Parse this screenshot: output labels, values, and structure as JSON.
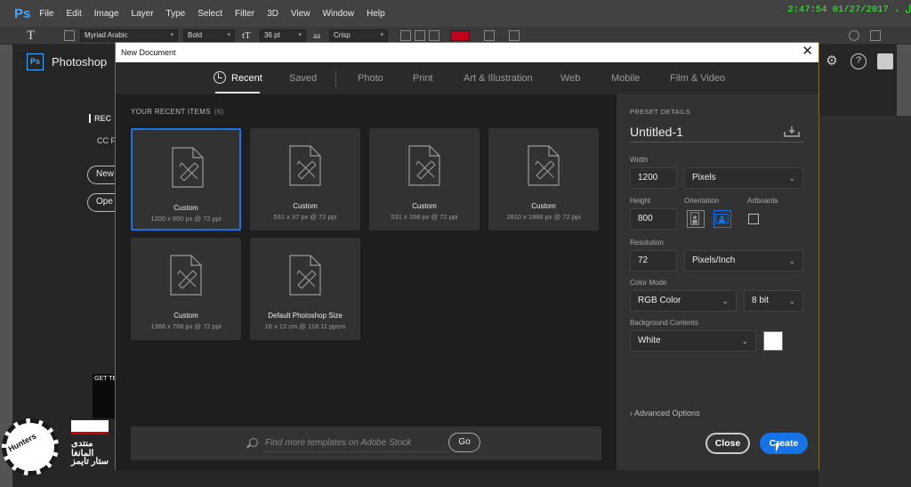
{
  "os": {
    "menu": [
      "File",
      "Edit",
      "Image",
      "Layer",
      "Type",
      "Select",
      "Filter",
      "3D",
      "View",
      "Window",
      "Help"
    ],
    "clock": "2:47:54 01/27/2017 ، ل"
  },
  "options_bar": {
    "font_family": "Myriad Arabic",
    "font_style": "Bold",
    "font_size": "36 pt",
    "antialias": "Crisp",
    "color_hex": "#c3001e"
  },
  "start_screen": {
    "app_title": "Photoshop",
    "recent_fragment": "REC",
    "cc_fragment": "CC F",
    "new_fragment": "New",
    "open_fragment": "Ope",
    "get_fragment": "GET TE"
  },
  "dialog": {
    "title": "New Document",
    "tabs": [
      "Recent",
      "Saved",
      "Photo",
      "Print",
      "Art & Illustration",
      "Web",
      "Mobile",
      "Film & Video"
    ],
    "recent_header": "YOUR RECENT ITEMS",
    "recent_count": "(6)",
    "items": [
      {
        "name": "Custom",
        "dims": "1200 x 800 px @ 72 ppi"
      },
      {
        "name": "Custom",
        "dims": "531 x 37 px @ 72 ppi"
      },
      {
        "name": "Custom",
        "dims": "531 x 168 px @ 72 ppi"
      },
      {
        "name": "Custom",
        "dims": "2810 x 1988 px @ 72 ppi"
      },
      {
        "name": "Custom",
        "dims": "1366 x 768 px @ 72 ppi"
      },
      {
        "name": "Default Photoshop Size",
        "dims": "16 x 12 cm @ 118.11 ppcm"
      }
    ],
    "search_placeholder": "Find more templates on Adobe Stock",
    "go_label": "Go",
    "preset": {
      "header": "PRESET DETAILS",
      "name": "Untitled-1",
      "width_label": "Width",
      "width": "1200",
      "width_unit": "Pixels",
      "height_label": "Height",
      "height": "800",
      "orientation_label": "Orientation",
      "artboards_label": "Artboards",
      "resolution_label": "Resolution",
      "resolution": "72",
      "resolution_unit": "Pixels/Inch",
      "color_mode_label": "Color Mode",
      "color_mode": "RGB Color",
      "bit_depth": "8 bit",
      "bg_label": "Background Contents",
      "bg_value": "White",
      "advanced": "Advanced Options"
    },
    "close_label": "Close",
    "create_label": "Create"
  },
  "watermark": {
    "logo_text": "Hunters",
    "line1": "منتدى المانغا",
    "line2": "ستار تايمز"
  }
}
